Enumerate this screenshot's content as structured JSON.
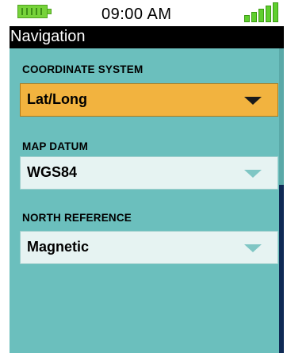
{
  "status_bar": {
    "time": "09:00 AM",
    "battery_icon": "battery-icon",
    "signal_icon": "signal-strength-icon"
  },
  "title_bar": {
    "title": "Navigation"
  },
  "settings": [
    {
      "label": "COORDINATE SYSTEM",
      "value": "Lat/Long",
      "state": "selected"
    },
    {
      "label": "MAP DATUM",
      "value": "WGS84",
      "state": "normal"
    },
    {
      "label": "NORTH REFERENCE",
      "value": "Magnetic",
      "state": "normal"
    }
  ],
  "colors": {
    "content_background": "#6bbfbd",
    "selected_field": "#f2b33f",
    "normal_field": "#e6f3f2",
    "title_bar": "#000000",
    "battery": "#77d33a",
    "signal": "#5fcf2e"
  }
}
